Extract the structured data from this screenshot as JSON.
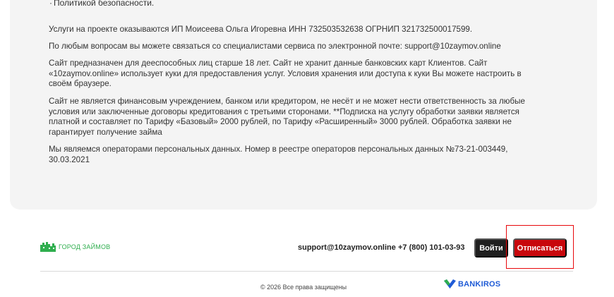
{
  "content": {
    "bullet_item": "Политикой безопасности.",
    "paragraphs": [
      "Услуги на проекте оказываются ИП Моисеева Ольга Игоревна ИНН 732503532638 ОГРНИП 321732500017599.",
      "По любым вопросам вы можете связаться со специалистами сервиса по электронной почте: support@10zaymov.online",
      "Сайт предназначен для дееспособных лиц старше 18 лет. Сайт не хранит данные банковских карт Клиентов. Сайт «10zaymov.online» использует куки для предоставления услуг. Условия хранения или доступа к куки Вы можете настроить в своём браузере.",
      "Сайт не является финансовым учреждением, банком или кредитором, не несёт и не может нести ответственность за любые условия или заключенные договоры кредитования с третьими сторонами. **Подписка на услугу обработки заявки является платной и составляет по Тарифу «Базовый» 2000 рублей, по Тарифу «Расширенный» 3000 рублей. Обработка заявки не гарантирует получение займа",
      "Мы являемся операторами персональных данных. Номер в реестре операторов персональных данных №73-21-003449, 30.03.2021"
    ]
  },
  "footer": {
    "logo_text": "ГОРОД ЗАЙМОВ",
    "email": "support@10zaymov.online",
    "phone": "+7 (800) 101-03-93",
    "login_label": "Войти",
    "unsubscribe_label": "Отписаться",
    "copyright": "© 2026 Все права защищены",
    "partner_logo_text": "BANKIROS"
  },
  "colors": {
    "brand_green": "#2fae4e",
    "unsubscribe_red": "#c8070c",
    "login_dark": "#1f1f1f",
    "partner_blue": "#1f5bd6",
    "highlight_red": "#e8080c"
  }
}
